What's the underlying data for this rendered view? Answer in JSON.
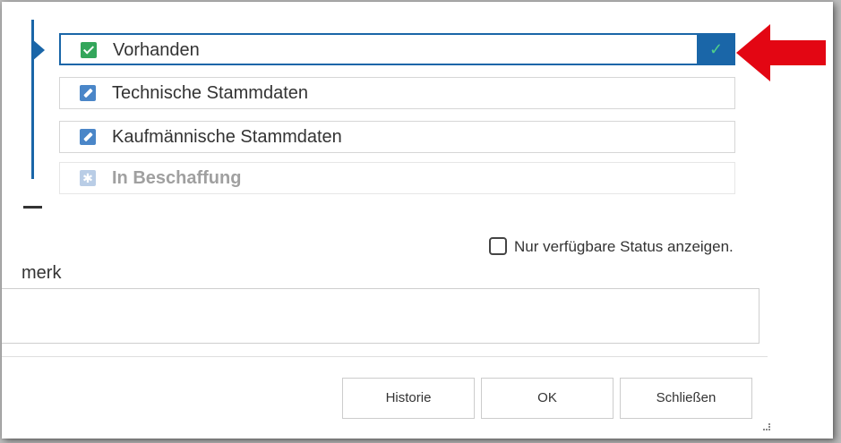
{
  "status_list": {
    "items": [
      {
        "label": "Vorhanden",
        "icon": "check-icon",
        "selected": true
      },
      {
        "label": "Technische Stammdaten",
        "icon": "edit-icon",
        "selected": false
      },
      {
        "label": "Kaufmännische Stammdaten",
        "icon": "edit-icon",
        "selected": false
      },
      {
        "label": "In Beschaffung",
        "icon": "star-icon",
        "selected": false,
        "disabled": true
      }
    ],
    "selected_check": "✓"
  },
  "filter": {
    "checkbox_label": "Nur verfügbare Status anzeigen.",
    "checked": false
  },
  "remark": {
    "label": "merk",
    "value": ""
  },
  "buttons": {
    "history": "Historie",
    "ok": "OK",
    "close": "Schließen"
  },
  "colors": {
    "accent": "#1a66a8",
    "check_green": "#33a65b",
    "edit_blue": "#4a86c8",
    "annotation_arrow": "#e30613"
  }
}
